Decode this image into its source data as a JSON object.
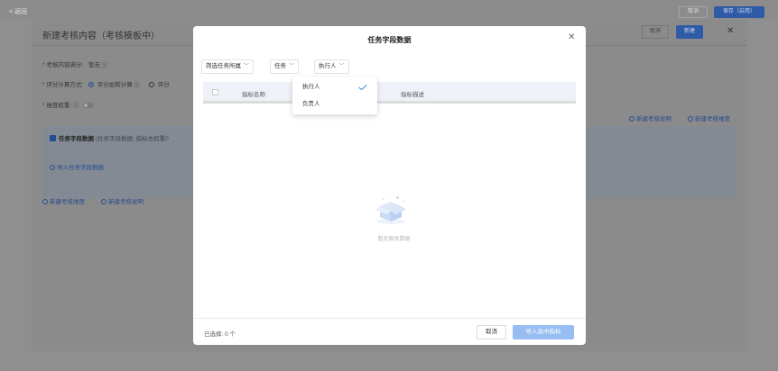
{
  "topbar": {
    "back_label": "< 返回",
    "cancel_label": "取消",
    "save_label": "保存（启用）"
  },
  "panel": {
    "title": "新建考核内容（考核模板中）",
    "cancel_label": "取消",
    "new_label": "新建",
    "close_glyph": "✕",
    "full_score_label": "考核内容满分:",
    "full_score_value": "暂无",
    "calc_method_label": "评分计算方式:",
    "calc_method_option1": "评分加和计算",
    "calc_method_option2": "评分",
    "dimension_weight_label": "维度权重:",
    "card_title": "任务字段数据",
    "card_subtitle": "(任务字段数据: 指标总权重0",
    "import_link": "导入任务字段数据",
    "add_dimension_link": "新建考核维度",
    "add_desc_link": "新建考核说明",
    "right_link_desc": "新建考核说明",
    "right_link_dim": "新建考核维度"
  },
  "modal": {
    "title": "任务字段数据",
    "close_glyph": "✕",
    "filter_owner": "筛选任务所属",
    "filter_task": "任务",
    "filter_person": "执行人",
    "col_name": "指标名称",
    "col_desc": "指标描述",
    "empty_text": "暂无相关数据",
    "selected_text": "已选择: 0 个",
    "cancel_label": "取消",
    "import_label": "导入选中指标"
  },
  "dropdown": {
    "options": [
      "执行人",
      "负责人"
    ],
    "selected": "执行人"
  },
  "colors": {
    "primary": "#2f5aa6",
    "import_disabled": "#97bdf2",
    "check": "#3a7ee8"
  }
}
